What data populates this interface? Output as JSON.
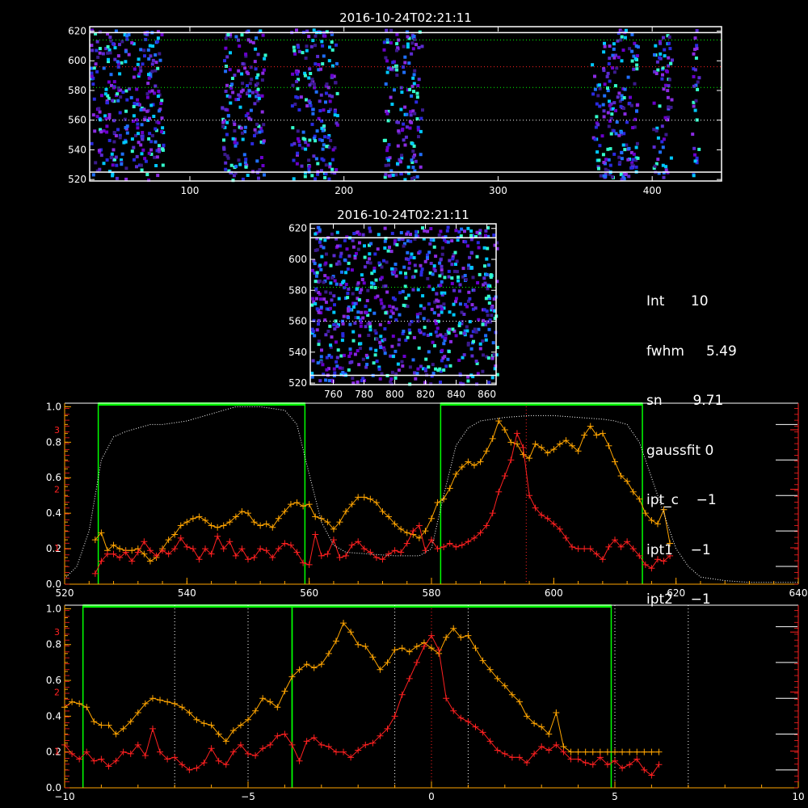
{
  "colors": {
    "frame": "#ffffff",
    "green": "#00ff00",
    "orange": "#ffa500",
    "red": "#ff2020",
    "dotted": "#ffffff",
    "rightAxis": "#ff2020"
  },
  "chart_data": [
    {
      "type": "heatmap",
      "title": "2016-10-24T02:21:11",
      "xlim": [
        35,
        445
      ],
      "ylim": [
        519,
        623
      ],
      "xticks": [
        100,
        200,
        300,
        400
      ],
      "yticks": [
        520,
        540,
        560,
        580,
        600,
        620
      ],
      "hlines_solid": [
        525,
        619
      ],
      "hlines_green_dotted": [
        582,
        614
      ],
      "hlines_red_dotted": [
        596
      ],
      "hlines_white_dotted": [
        560
      ],
      "bands": [
        [
          35,
          82
        ],
        [
          120,
          148
        ],
        [
          165,
          195
        ],
        [
          225,
          250
        ],
        [
          360,
          390
        ],
        [
          400,
          412
        ],
        [
          425,
          430
        ]
      ]
    },
    {
      "type": "heatmap",
      "title": "2016-10-24T02:21:11",
      "xlim": [
        745,
        866
      ],
      "ylim": [
        519,
        623
      ],
      "xticks": [
        760,
        780,
        800,
        820,
        840,
        860
      ],
      "yticks": [
        520,
        540,
        560,
        580,
        600,
        620
      ],
      "hlines_solid": [
        525,
        614
      ],
      "hlines_green_dotted": [
        582
      ],
      "hlines_white_dotted": [
        560
      ]
    },
    {
      "type": "line",
      "xlim": [
        520,
        640
      ],
      "ylim": [
        0,
        1.02
      ],
      "xticks": [
        520,
        540,
        560,
        580,
        600,
        620,
        640
      ],
      "yticks": [
        0.0,
        0.2,
        0.4,
        0.6,
        0.8,
        1.0
      ],
      "right_yticks": [
        "1",
        "2",
        "3"
      ],
      "right_ytick_values": [
        0.205,
        0.535,
        0.87
      ],
      "green_boxes": [
        [
          525.5,
          559.3
        ],
        [
          581.5,
          614.5
        ]
      ],
      "red_vline": 595.5,
      "series": [
        {
          "color": "orange",
          "x": [
            525,
            526,
            527,
            528,
            529,
            530,
            531,
            532,
            533,
            534,
            535,
            536,
            537,
            538,
            539,
            540,
            541,
            542,
            543,
            544,
            545,
            546,
            547,
            548,
            549,
            550,
            551,
            552,
            553,
            554,
            555,
            556,
            557,
            558,
            559,
            560,
            561,
            562,
            563,
            564,
            565,
            566,
            567,
            568,
            569,
            570,
            571,
            572,
            573,
            574,
            575,
            576,
            577,
            578,
            579,
            580,
            581,
            582,
            583,
            584,
            585,
            586,
            587,
            588,
            589,
            590,
            591,
            592,
            593,
            594,
            595,
            596,
            597,
            598,
            599,
            600,
            601,
            602,
            603,
            604,
            605,
            606,
            607,
            608,
            609,
            610,
            611,
            612,
            613,
            614,
            615,
            616,
            617,
            618,
            619
          ],
          "values": [
            0.25,
            0.29,
            0.19,
            0.22,
            0.2,
            0.19,
            0.19,
            0.2,
            0.17,
            0.13,
            0.15,
            0.2,
            0.25,
            0.28,
            0.33,
            0.35,
            0.37,
            0.38,
            0.36,
            0.33,
            0.32,
            0.33,
            0.35,
            0.38,
            0.41,
            0.4,
            0.35,
            0.33,
            0.34,
            0.32,
            0.37,
            0.41,
            0.45,
            0.46,
            0.44,
            0.45,
            0.38,
            0.37,
            0.35,
            0.31,
            0.35,
            0.41,
            0.45,
            0.49,
            0.49,
            0.48,
            0.46,
            0.41,
            0.38,
            0.34,
            0.31,
            0.29,
            0.28,
            0.26,
            0.3,
            0.37,
            0.46,
            0.48,
            0.54,
            0.62,
            0.66,
            0.69,
            0.67,
            0.69,
            0.75,
            0.82,
            0.92,
            0.87,
            0.8,
            0.79,
            0.73,
            0.71,
            0.79,
            0.77,
            0.74,
            0.76,
            0.79,
            0.81,
            0.78,
            0.75,
            0.84,
            0.89,
            0.84,
            0.85,
            0.78,
            0.69,
            0.61,
            0.58,
            0.52,
            0.48,
            0.4,
            0.36,
            0.34,
            0.42,
            0.23
          ]
        },
        {
          "color": "red",
          "x": [
            525,
            526,
            527,
            528,
            529,
            530,
            531,
            532,
            533,
            534,
            535,
            536,
            537,
            538,
            539,
            540,
            541,
            542,
            543,
            544,
            545,
            546,
            547,
            548,
            549,
            550,
            551,
            552,
            553,
            554,
            555,
            556,
            557,
            558,
            559,
            560,
            561,
            562,
            563,
            564,
            565,
            566,
            567,
            568,
            569,
            570,
            571,
            572,
            573,
            574,
            575,
            576,
            577,
            578,
            579,
            580,
            581,
            582,
            583,
            584,
            585,
            586,
            587,
            588,
            589,
            590,
            591,
            592,
            593,
            594,
            595,
            596,
            597,
            598,
            599,
            600,
            601,
            602,
            603,
            604,
            605,
            606,
            607,
            608,
            609,
            610,
            611,
            612,
            613,
            614,
            615,
            616,
            617,
            618,
            619
          ],
          "values": [
            0.06,
            0.13,
            0.17,
            0.17,
            0.15,
            0.18,
            0.13,
            0.18,
            0.24,
            0.19,
            0.16,
            0.19,
            0.17,
            0.2,
            0.26,
            0.21,
            0.2,
            0.14,
            0.2,
            0.17,
            0.27,
            0.2,
            0.24,
            0.16,
            0.2,
            0.14,
            0.15,
            0.2,
            0.19,
            0.15,
            0.2,
            0.23,
            0.22,
            0.18,
            0.12,
            0.11,
            0.28,
            0.16,
            0.17,
            0.25,
            0.15,
            0.16,
            0.22,
            0.24,
            0.2,
            0.18,
            0.15,
            0.14,
            0.17,
            0.19,
            0.18,
            0.23,
            0.3,
            0.33,
            0.19,
            0.25,
            0.2,
            0.21,
            0.23,
            0.21,
            0.22,
            0.24,
            0.26,
            0.29,
            0.33,
            0.4,
            0.52,
            0.61,
            0.7,
            0.85,
            0.77,
            0.5,
            0.43,
            0.39,
            0.37,
            0.34,
            0.31,
            0.26,
            0.21,
            0.2,
            0.2,
            0.2,
            0.17,
            0.14,
            0.21,
            0.25,
            0.21,
            0.24,
            0.2,
            0.16,
            0.11,
            0.09,
            0.14,
            0.13,
            0.16
          ]
        },
        {
          "color": "white-dotted",
          "x": [
            520,
            522,
            524,
            526,
            528,
            530,
            532,
            534,
            536,
            540,
            544,
            548,
            552,
            556,
            558,
            560,
            562,
            564,
            566,
            570,
            574,
            578,
            580,
            582,
            584,
            586,
            588,
            592,
            596,
            600,
            604,
            608,
            610,
            612,
            614,
            616,
            618,
            620,
            622,
            624,
            628,
            632,
            636,
            640
          ],
          "values": [
            0.03,
            0.1,
            0.3,
            0.7,
            0.83,
            0.86,
            0.88,
            0.9,
            0.9,
            0.92,
            0.96,
            1.0,
            1.0,
            0.98,
            0.9,
            0.62,
            0.35,
            0.22,
            0.18,
            0.17,
            0.16,
            0.16,
            0.2,
            0.5,
            0.78,
            0.88,
            0.92,
            0.94,
            0.95,
            0.95,
            0.94,
            0.93,
            0.92,
            0.9,
            0.8,
            0.6,
            0.4,
            0.2,
            0.1,
            0.04,
            0.02,
            0.01,
            0.01,
            0.01
          ]
        }
      ]
    },
    {
      "type": "line",
      "xlim": [
        -10,
        10
      ],
      "ylim": [
        0,
        1.02
      ],
      "xticks": [
        -10,
        -5,
        0,
        5,
        10
      ],
      "yticks": [
        0.0,
        0.2,
        0.4,
        0.6,
        0.8,
        1.0
      ],
      "right_yticks": [
        "1",
        "2",
        "3"
      ],
      "right_ytick_values": [
        0.205,
        0.535,
        0.87
      ],
      "green_boxes": [
        [
          -9.5,
          -3.8
        ],
        [
          -3.8,
          4.9
        ]
      ],
      "red_vline": 0,
      "white_vlines": [
        -7,
        -5,
        -1,
        1,
        5,
        7
      ],
      "series": [
        {
          "color": "orange",
          "x": [
            -10,
            -9.8,
            -9.6,
            -9.4,
            -9.2,
            -9.0,
            -8.8,
            -8.6,
            -8.4,
            -8.2,
            -8.0,
            -7.8,
            -7.6,
            -7.4,
            -7.2,
            -7.0,
            -6.8,
            -6.6,
            -6.4,
            -6.2,
            -6.0,
            -5.8,
            -5.6,
            -5.4,
            -5.2,
            -5.0,
            -4.8,
            -4.6,
            -4.4,
            -4.2,
            -4.0,
            -3.8,
            -3.6,
            -3.4,
            -3.2,
            -3.0,
            -2.8,
            -2.6,
            -2.4,
            -2.2,
            -2.0,
            -1.8,
            -1.6,
            -1.4,
            -1.2,
            -1.0,
            -0.8,
            -0.6,
            -0.4,
            -0.2,
            0.0,
            0.2,
            0.4,
            0.6,
            0.8,
            1.0,
            1.2,
            1.4,
            1.6,
            1.8,
            2.0,
            2.2,
            2.4,
            2.6,
            2.8,
            3.0,
            3.2,
            3.4,
            3.6,
            3.8,
            4.0,
            4.2,
            4.4,
            4.6,
            4.8,
            5.0,
            5.2,
            5.4,
            5.6,
            5.8,
            6.0,
            6.2
          ],
          "values": [
            0.45,
            0.48,
            0.47,
            0.45,
            0.37,
            0.35,
            0.35,
            0.3,
            0.33,
            0.37,
            0.42,
            0.47,
            0.5,
            0.49,
            0.48,
            0.47,
            0.45,
            0.42,
            0.38,
            0.36,
            0.35,
            0.3,
            0.26,
            0.32,
            0.35,
            0.38,
            0.43,
            0.5,
            0.48,
            0.45,
            0.54,
            0.62,
            0.66,
            0.69,
            0.67,
            0.69,
            0.75,
            0.82,
            0.92,
            0.87,
            0.8,
            0.79,
            0.73,
            0.66,
            0.7,
            0.77,
            0.78,
            0.76,
            0.79,
            0.81,
            0.78,
            0.75,
            0.84,
            0.89,
            0.84,
            0.85,
            0.78,
            0.71,
            0.66,
            0.61,
            0.57,
            0.52,
            0.48,
            0.4,
            0.36,
            0.34,
            0.3,
            0.42,
            0.23,
            0.2,
            0.2,
            0.2,
            0.2,
            0.2,
            0.2,
            0.2,
            0.2,
            0.2,
            0.2,
            0.2,
            0.2,
            0.2
          ]
        },
        {
          "color": "red",
          "x": [
            -10,
            -9.8,
            -9.6,
            -9.4,
            -9.2,
            -9.0,
            -8.8,
            -8.6,
            -8.4,
            -8.2,
            -8.0,
            -7.8,
            -7.6,
            -7.4,
            -7.2,
            -7.0,
            -6.8,
            -6.6,
            -6.4,
            -6.2,
            -6.0,
            -5.8,
            -5.6,
            -5.4,
            -5.2,
            -5.0,
            -4.8,
            -4.6,
            -4.4,
            -4.2,
            -4.0,
            -3.8,
            -3.6,
            -3.4,
            -3.2,
            -3.0,
            -2.8,
            -2.6,
            -2.4,
            -2.2,
            -2.0,
            -1.8,
            -1.6,
            -1.4,
            -1.2,
            -1.0,
            -0.8,
            -0.6,
            -0.4,
            -0.2,
            0.0,
            0.2,
            0.4,
            0.6,
            0.8,
            1.0,
            1.2,
            1.4,
            1.6,
            1.8,
            2.0,
            2.2,
            2.4,
            2.6,
            2.8,
            3.0,
            3.2,
            3.4,
            3.6,
            3.8,
            4.0,
            4.2,
            4.4,
            4.6,
            4.8,
            5.0,
            5.2,
            5.4,
            5.6,
            5.8,
            6.0,
            6.2
          ],
          "values": [
            0.24,
            0.19,
            0.16,
            0.2,
            0.15,
            0.16,
            0.12,
            0.15,
            0.2,
            0.19,
            0.24,
            0.18,
            0.33,
            0.2,
            0.16,
            0.17,
            0.13,
            0.1,
            0.11,
            0.14,
            0.22,
            0.15,
            0.13,
            0.2,
            0.24,
            0.19,
            0.18,
            0.22,
            0.24,
            0.29,
            0.3,
            0.24,
            0.15,
            0.26,
            0.28,
            0.24,
            0.23,
            0.2,
            0.2,
            0.17,
            0.21,
            0.24,
            0.25,
            0.29,
            0.33,
            0.4,
            0.52,
            0.61,
            0.7,
            0.79,
            0.85,
            0.77,
            0.5,
            0.43,
            0.39,
            0.37,
            0.34,
            0.31,
            0.26,
            0.21,
            0.19,
            0.17,
            0.17,
            0.14,
            0.19,
            0.23,
            0.21,
            0.24,
            0.2,
            0.16,
            0.16,
            0.14,
            0.13,
            0.17,
            0.13,
            0.15,
            0.11,
            0.13,
            0.16,
            0.1,
            0.07,
            0.13
          ]
        }
      ]
    }
  ],
  "info": {
    "lines": [
      "Int      10",
      "fwhm     5.49",
      "sn       9.71",
      "gaussfit 0",
      "ipt_c    −1",
      "ipt1    −1",
      "ipt2    −1"
    ]
  }
}
